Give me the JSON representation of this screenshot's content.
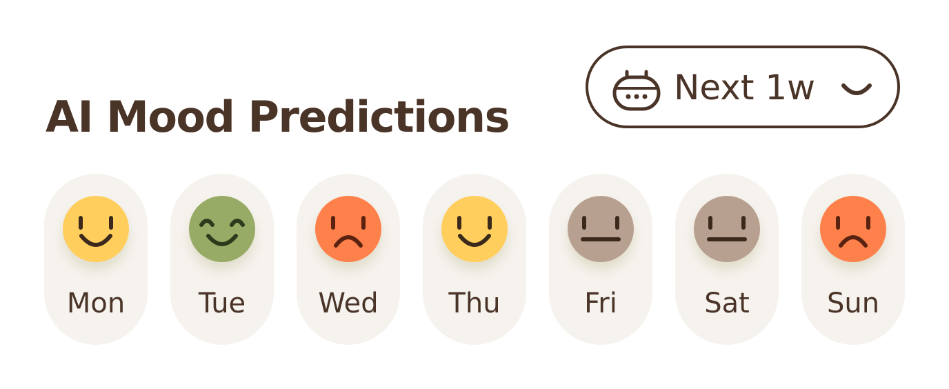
{
  "header": {
    "title": "AI Mood Predictions"
  },
  "range_selector": {
    "label": "Next 1w",
    "icon": "robot-icon"
  },
  "colors": {
    "text": "#4a3327",
    "card_bg": "#f6f3ef",
    "happy": "#ffce5c",
    "content": "#98ab66",
    "sad": "#fe814b",
    "neutral": "#b8a090"
  },
  "days": [
    {
      "label": "Mon",
      "mood": "happy",
      "color": "#ffce5c"
    },
    {
      "label": "Tue",
      "mood": "content",
      "color": "#98ab66"
    },
    {
      "label": "Wed",
      "mood": "sad",
      "color": "#fe814b"
    },
    {
      "label": "Thu",
      "mood": "happy",
      "color": "#ffce5c"
    },
    {
      "label": "Fri",
      "mood": "neutral",
      "color": "#b8a090"
    },
    {
      "label": "Sat",
      "mood": "neutral",
      "color": "#b8a090"
    },
    {
      "label": "Sun",
      "mood": "sad",
      "color": "#fe814b"
    }
  ]
}
